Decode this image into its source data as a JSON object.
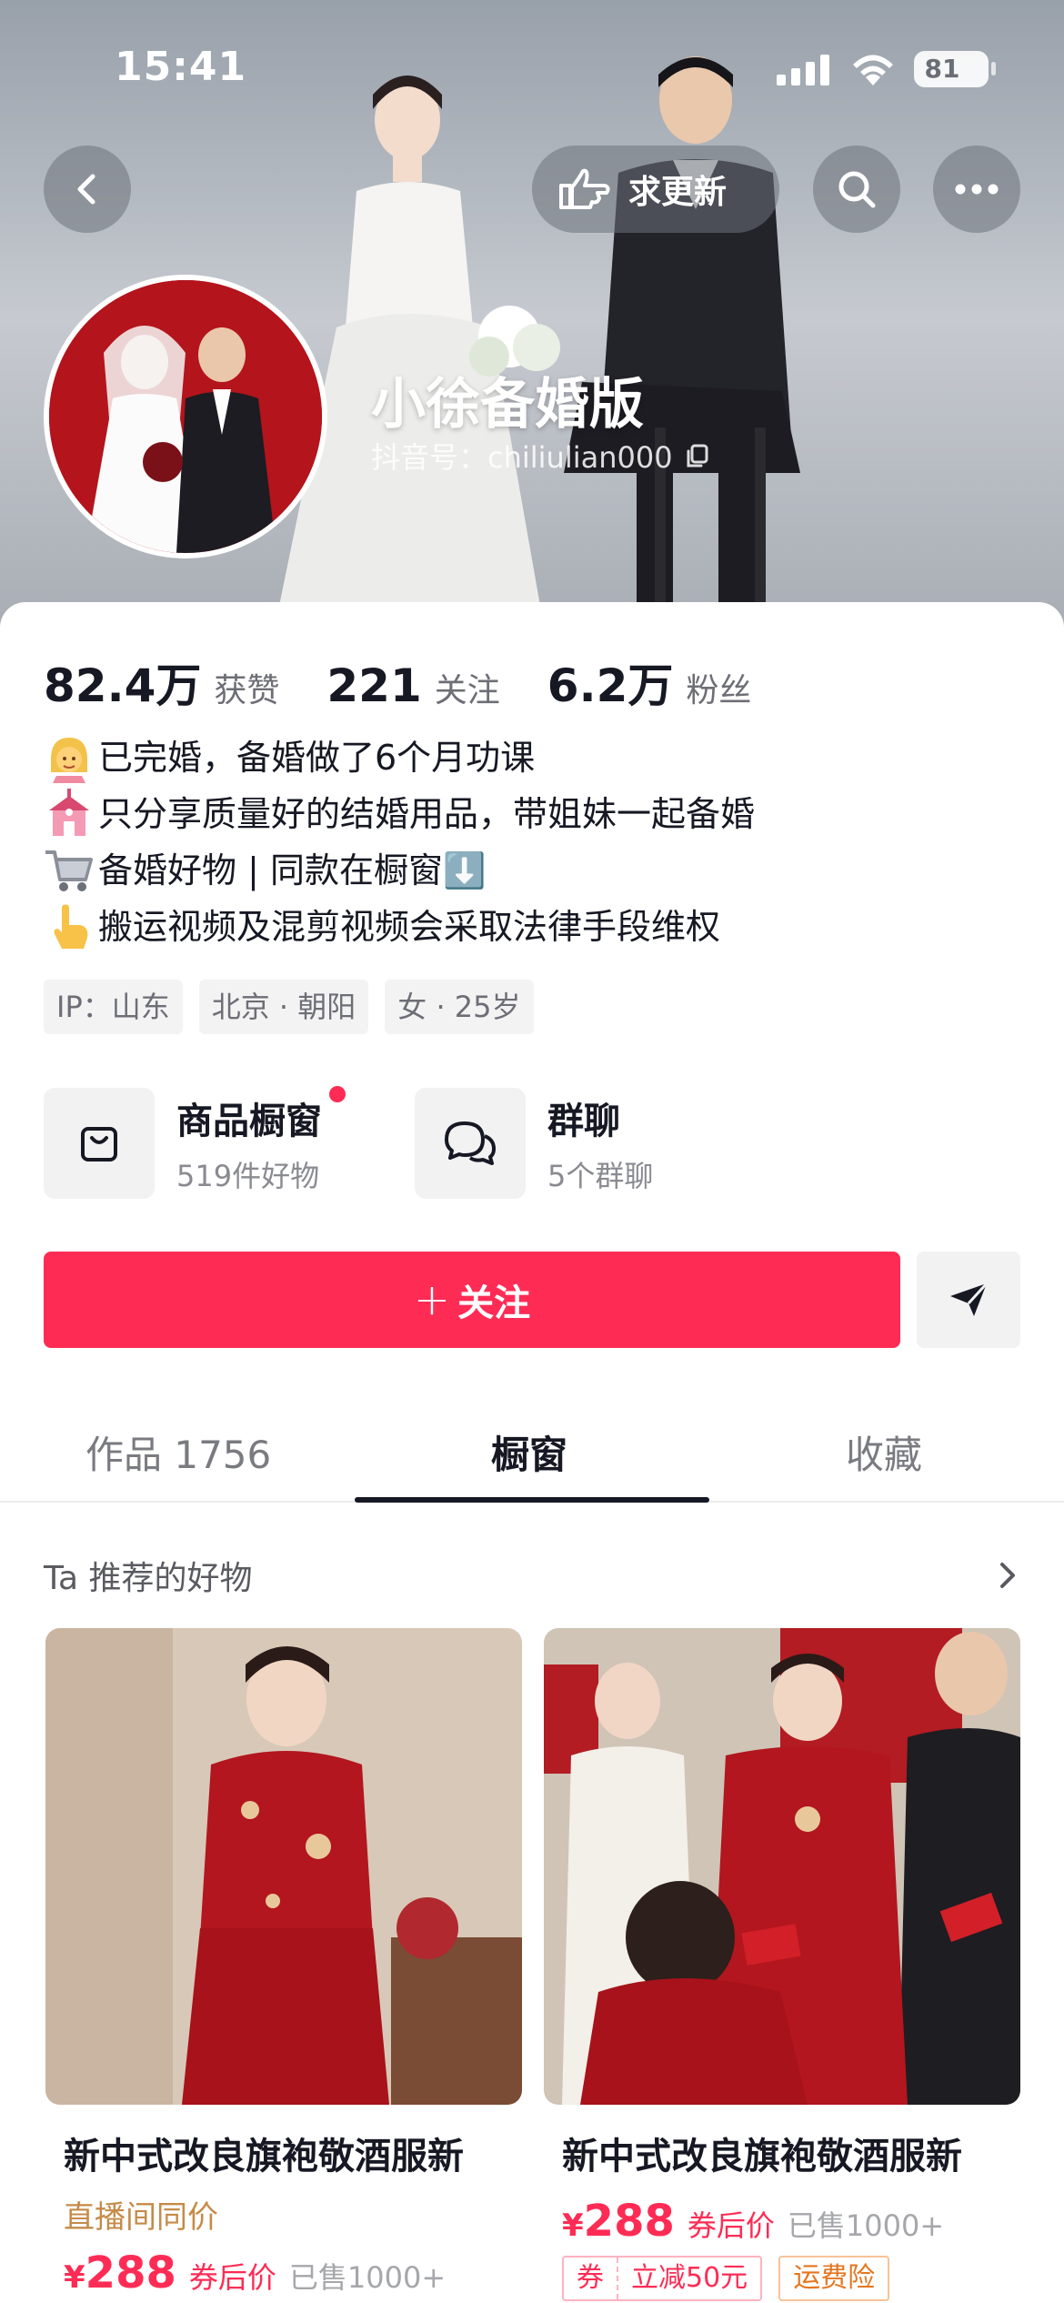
{
  "status_bar": {
    "time": "15:41",
    "battery": "81"
  },
  "header": {
    "back_icon": "chevron-left-icon",
    "request_update_label": "求更新",
    "request_update_icon": "hand-point-icon",
    "search_icon": "search-icon",
    "more_icon": "more-dots-icon"
  },
  "profile": {
    "nickname": "小徐备婚版",
    "douyin_id": "抖音号：chiliulian000",
    "copy_icon": "copy-icon"
  },
  "stats": [
    {
      "value": "82.4万",
      "label": "获赞"
    },
    {
      "value": "221",
      "label": "关注"
    },
    {
      "value": "6.2万",
      "label": "粉丝"
    }
  ],
  "bio": [
    {
      "emoji": "bride-icon",
      "text": "已完婚，备婚做了6个月功课"
    },
    {
      "emoji": "wedding-chapel-icon",
      "text": "只分享质量好的结婚用品，带姐妹一起备婚"
    },
    {
      "emoji": "shopping-cart-icon",
      "text": "备婚好物 | 同款在橱窗⬇️"
    },
    {
      "emoji": "pointing-hand-icon",
      "text": "搬运视频及混剪视频会采取法律手段维权"
    }
  ],
  "tags": [
    "IP：山东",
    "北京 · 朝阳",
    "女 · 25岁"
  ],
  "entries": {
    "shop": {
      "title": "商品橱窗",
      "subtitle": "519件好物"
    },
    "group": {
      "title": "群聊",
      "subtitle": "5个群聊"
    }
  },
  "actions": {
    "follow_label": "关注",
    "follow_plus": "+"
  },
  "tabs": [
    {
      "label": "作品 1756",
      "active": false
    },
    {
      "label": "橱窗",
      "active": true
    },
    {
      "label": "收藏",
      "active": false
    }
  ],
  "section": {
    "title": "Ta 推荐的好物"
  },
  "products": [
    {
      "title": "新中式改良旗袍敬酒服新",
      "subtitle": "直播间同价",
      "currency": "¥",
      "price": "288",
      "after_coupon": "券后价",
      "sold": "已售1000+"
    },
    {
      "title": "新中式改良旗袍敬酒服新",
      "currency": "¥",
      "price": "288",
      "after_coupon": "券后价",
      "sold": "已售1000+",
      "coupon_label": "券",
      "coupon_value": "立减50元",
      "insurance_label": "运费险"
    }
  ],
  "colors": {
    "accent": "#fe2c55",
    "gold": "#c58b48"
  }
}
